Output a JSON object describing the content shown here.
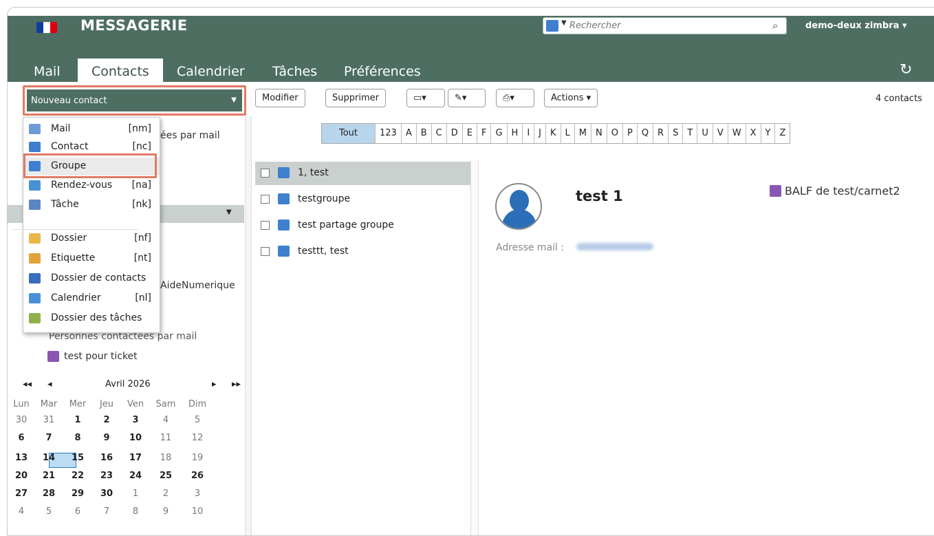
{
  "header": {
    "brand": "MESSAGERIE",
    "search_placeholder": "Rechercher",
    "user": "demo-deux zimbra ▾",
    "tabs": [
      "Mail",
      "Contacts",
      "Calendrier",
      "Tâches",
      "Préférences"
    ],
    "active_tab": "Contacts",
    "flag_colors": [
      "#0f3ea1",
      "#ffffff",
      "#e1000f"
    ]
  },
  "toolbar": {
    "new_contact": "Nouveau contact",
    "modify": "Modifier",
    "delete": "Supprimer",
    "actions": "Actions ▾",
    "count": "4 contacts"
  },
  "new_menu": {
    "items": [
      {
        "label": "Mail",
        "shortcut": "[nm]",
        "icon": "mail-icon"
      },
      {
        "label": "Contact",
        "shortcut": "[nc]",
        "icon": "contact-icon"
      },
      {
        "label": "Groupe",
        "shortcut": "",
        "icon": "group-icon"
      },
      {
        "label": "Rendez-vous",
        "shortcut": "[na]",
        "icon": "appointment-icon"
      },
      {
        "label": "Tâche",
        "shortcut": "[nk]",
        "icon": "task-icon"
      },
      {
        "label": "Dossier",
        "shortcut": "[nf]",
        "icon": "folder-icon"
      },
      {
        "label": "Etiquette",
        "shortcut": "[nt]",
        "icon": "tag-icon"
      },
      {
        "label": "Dossier de contacts",
        "shortcut": "",
        "icon": "contacts-folder-icon"
      },
      {
        "label": "Calendrier",
        "shortcut": "[nl]",
        "icon": "calendar-icon"
      },
      {
        "label": "Dossier des tâches",
        "shortcut": "",
        "icon": "tasks-folder-icon"
      }
    ]
  },
  "left_panel": {
    "partial_1": "ées par mail",
    "partial_2": "AideNumerique",
    "partial_3": "Personnes contactées par mail",
    "folder": "test pour ticket"
  },
  "calendar": {
    "month": "Avril 2026",
    "nav": [
      "◂◂",
      "◂",
      "▸",
      "▸▸"
    ],
    "weekdays": [
      "Lun",
      "Mar",
      "Mer",
      "Jeu",
      "Ven",
      "Sam",
      "Dim"
    ],
    "weeks": [
      [
        "30",
        "31",
        "1",
        "2",
        "3",
        "4",
        "5"
      ],
      [
        "6",
        "7",
        "8",
        "9",
        "10",
        "11",
        "12"
      ],
      [
        "13",
        "14",
        "15",
        "16",
        "17",
        "18",
        "19"
      ],
      [
        "20",
        "21",
        "22",
        "23",
        "24",
        "25",
        "26"
      ],
      [
        "27",
        "28",
        "29",
        "30",
        "1",
        "2",
        "3"
      ],
      [
        "4",
        "5",
        "6",
        "7",
        "8",
        "9",
        "10"
      ]
    ],
    "today": "14"
  },
  "alphabet": [
    "Tout",
    "123",
    "A",
    "B",
    "C",
    "D",
    "E",
    "F",
    "G",
    "H",
    "I",
    "J",
    "K",
    "L",
    "M",
    "N",
    "O",
    "P",
    "Q",
    "R",
    "S",
    "T",
    "U",
    "V",
    "W",
    "X",
    "Y",
    "Z"
  ],
  "contacts": [
    {
      "name": "1, test",
      "type": "contact"
    },
    {
      "name": "testgroupe",
      "type": "group"
    },
    {
      "name": "test partage groupe",
      "type": "group"
    },
    {
      "name": "testtt, test",
      "type": "contact"
    }
  ],
  "detail": {
    "name": "test 1",
    "addressbook": "BALF de test/carnet2",
    "mail_label": "Adresse mail :"
  }
}
